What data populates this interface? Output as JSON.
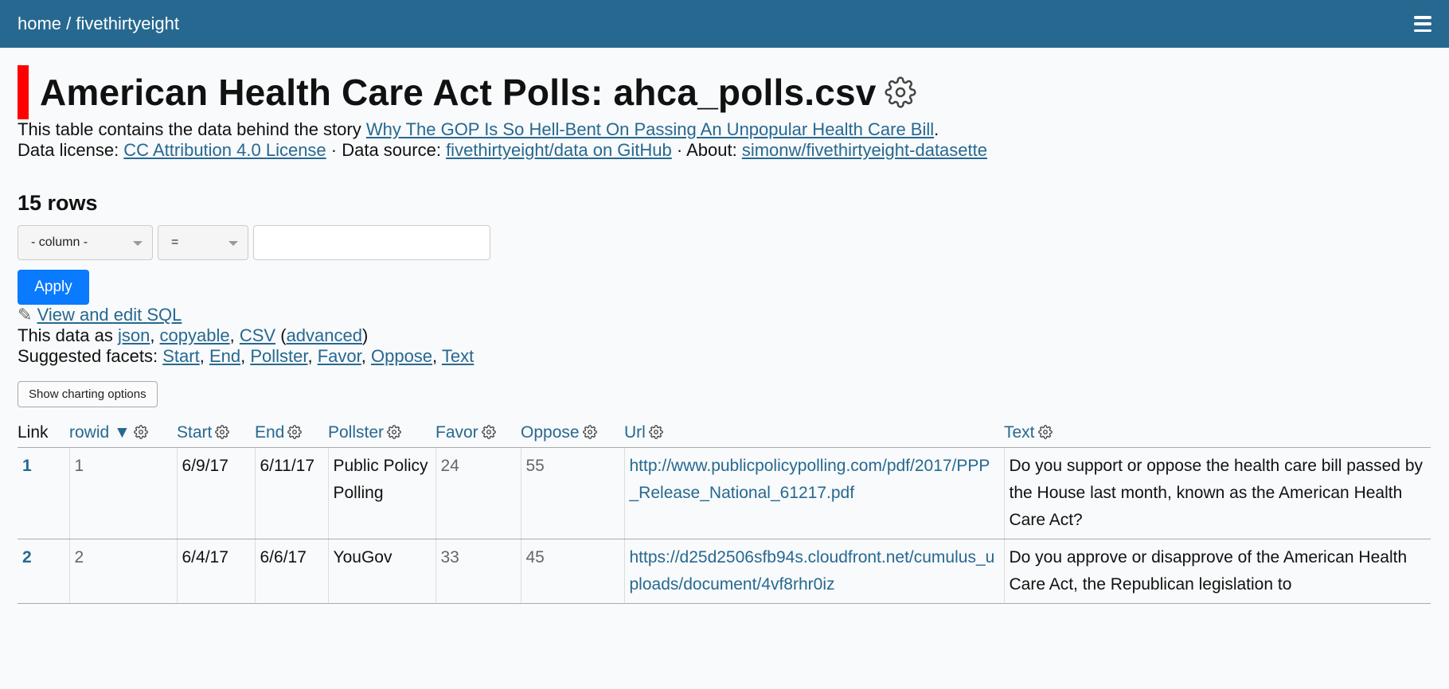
{
  "topbar": {
    "breadcrumb": "home / fivethirtyeight"
  },
  "page": {
    "title": "American Health Care Act Polls: ahca_polls.csv",
    "description_prefix": "This table contains the data behind the story ",
    "story_link": "Why The GOP Is So Hell-Bent On Passing An Unpopular Health Care Bill",
    "description_suffix": ".",
    "license_label": "Data license: ",
    "license_link": "CC Attribution 4.0 License",
    "source_label": " · Data source: ",
    "source_link": "fivethirtyeight/data on GitHub",
    "about_label": " · About: ",
    "about_link": "simonw/fivethirtyeight-datasette",
    "rows_count": "15 rows"
  },
  "filters": {
    "column_placeholder": "- column -",
    "operator": "=",
    "value": "",
    "apply_label": "Apply"
  },
  "sql_link": "View and edit SQL",
  "export": {
    "prefix": "This data as ",
    "json": "json",
    "copyable": "copyable",
    "csv": "CSV",
    "advanced": "advanced"
  },
  "facets": {
    "label": "Suggested facets: ",
    "items": [
      "Start",
      "End",
      "Pollster",
      "Favor",
      "Oppose",
      "Text"
    ]
  },
  "chart_button": "Show charting options",
  "table": {
    "columns": [
      "Link",
      "rowid ▼",
      "Start",
      "End",
      "Pollster",
      "Favor",
      "Oppose",
      "Url",
      "Text"
    ],
    "rows": [
      {
        "link": "1",
        "rowid": "1",
        "start": "6/9/17",
        "end": "6/11/17",
        "pollster": "Public Policy Polling",
        "favor": "24",
        "oppose": "55",
        "url": "http://www.publicpolicypolling.com/pdf/2017/PPP_Release_National_61217.pdf",
        "text": "Do you support or oppose the health care bill passed by the House last month, known as the American Health Care Act?"
      },
      {
        "link": "2",
        "rowid": "2",
        "start": "6/4/17",
        "end": "6/6/17",
        "pollster": "YouGov",
        "favor": "33",
        "oppose": "45",
        "url": "https://d25d2506sfb94s.cloudfront.net/cumulus_uploads/document/4vf8rhr0iz",
        "text": "Do you approve or disapprove of the American Health Care Act, the Republican legislation to"
      }
    ]
  }
}
